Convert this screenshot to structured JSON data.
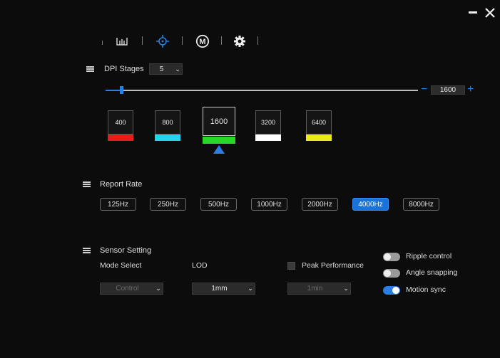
{
  "window": {
    "minimize_icon": "minimize-icon",
    "close_icon": "close-icon"
  },
  "nav": {
    "items": [
      "buttons-icon",
      "performance-icon",
      "macro-icon",
      "settings-icon"
    ],
    "macro_glyph": "M"
  },
  "dpi": {
    "title": "DPI Stages",
    "stages_select": "5",
    "slider_value": "1600",
    "minus": "−",
    "plus": "+",
    "stages": [
      {
        "label": "400",
        "color": "#e81c1c"
      },
      {
        "label": "800",
        "color": "#24d4e8"
      },
      {
        "label": "1600",
        "color": "#27d827"
      },
      {
        "label": "3200",
        "color": "#ffffff"
      },
      {
        "label": "6400",
        "color": "#eaea1a"
      }
    ],
    "selected_index": 2,
    "slider_fraction": 0.05
  },
  "report_rate": {
    "title": "Report Rate",
    "options": [
      "125Hz",
      "250Hz",
      "500Hz",
      "1000Hz",
      "2000Hz",
      "4000Hz",
      "8000Hz"
    ],
    "selected": "4000Hz"
  },
  "sensor": {
    "title": "Sensor Setting",
    "mode_select_label": "Mode Select",
    "mode_select_value": "Control",
    "lod_label": "LOD",
    "lod_value": "1mm",
    "peak_performance_label": "Peak Performance",
    "peak_performance_value": "1min",
    "toggles": [
      {
        "label": "Ripple control",
        "on": false
      },
      {
        "label": "Angle snapping",
        "on": false
      },
      {
        "label": "Motion sync",
        "on": true
      }
    ]
  },
  "colors": {
    "accent": "#1a73d8",
    "background": "#0c0c0c"
  }
}
